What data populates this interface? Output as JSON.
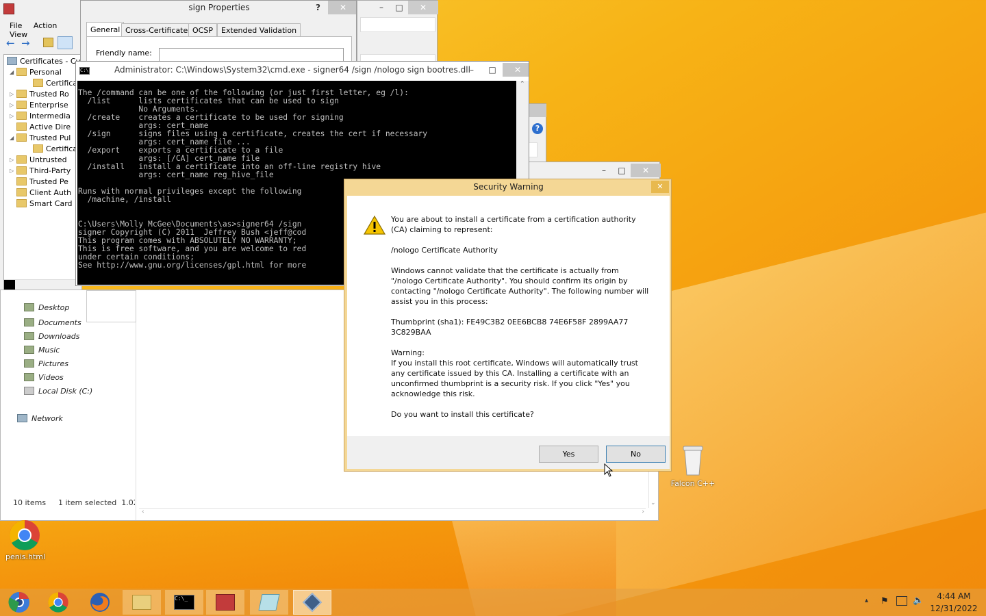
{
  "mmc": {
    "menu": [
      "File",
      "Action",
      "View"
    ],
    "tree": [
      "Certificates - Cur",
      "Personal",
      "Certifica",
      "Trusted Ro",
      "Enterprise",
      "Intermedia",
      "Active Dire",
      "Trusted Pul",
      "Certifica",
      "Untrusted",
      "Third-Party",
      "Trusted Pe",
      "Client Auth",
      "Smart Card"
    ]
  },
  "explorer": {
    "nav": [
      "Desktop",
      "Documents",
      "Downloads",
      "Music",
      "Pictures",
      "Videos",
      "Local Disk (C:)"
    ],
    "network": "Network",
    "status_items": "10 items",
    "status_selected": "1 item selected  1.02"
  },
  "props": {
    "title": "sign Properties",
    "tabs": [
      "General",
      "Cross-Certificates",
      "OCSP",
      "Extended Validation"
    ],
    "friendly_name_label": "Friendly name:",
    "help": "?"
  },
  "cmd": {
    "title": "Administrator: C:\\Windows\\System32\\cmd.exe - signer64  /sign /nologo sign bootres.dll",
    "lines": [
      "The /command can be one of the following (or just first letter, eg /l):",
      "  /list      lists certificates that can be used to sign",
      "             No Arguments.",
      "  /create    creates a certificate to be used for signing",
      "             args: cert_name",
      "  /sign      signs files using a certificate, creates the cert if necessary",
      "             args: cert_name file ...",
      "  /export    exports a certificate to a file",
      "             args: [/CA] cert_name file",
      "  /install   install a certificate into an off-line registry hive",
      "             args: cert_name reg_hive_file",
      "",
      "Runs with normal privileges except the following",
      "  /machine, /install",
      "",
      "",
      "C:\\Users\\Molly McGee\\Documents\\as>signer64 /sign",
      "signer Copyright (C) 2011  Jeffrey Bush <jeff@cod",
      "This program comes with ABSOLUTELY NO WARRANTY;",
      "This is free software, and you are welcome to red",
      "under certain conditions;",
      "See http://www.gnu.org/licenses/gpl.html for more"
    ]
  },
  "dialog": {
    "title": "Security Warning",
    "p1": "You are about to install a certificate from a certification authority (CA) claiming to represent:",
    "p2": "/nologo Certificate Authority",
    "p3": "Windows cannot validate that the certificate is actually from \"/nologo Certificate Authority\". You should confirm its origin by contacting \"/nologo Certificate Authority\". The following number will assist you in this process:",
    "p4": "Thumbprint (sha1): FE49C3B2 0EE6BCB8 74E6F58F 2899AA77 3C829BAA",
    "p5": "Warning:",
    "p6": "If you install this root certificate, Windows will automatically trust any certificate issued by this CA. Installing a certificate with an unconfirmed thumbprint is a security risk. If you click \"Yes\" you acknowledge this risk.",
    "p7": "Do you want to install this certificate?",
    "yes": "Yes",
    "no": "No",
    "close": "✕"
  },
  "desktop": {
    "chrome_label": "penis.html",
    "recycle_label": "Falcon C++"
  },
  "clock": {
    "time": "4:44 AM",
    "date": "12/31/2022"
  },
  "colors": {
    "dialog_frame": "#f4d795",
    "cmd_bg": "#000000",
    "accent": "#f7b316"
  }
}
